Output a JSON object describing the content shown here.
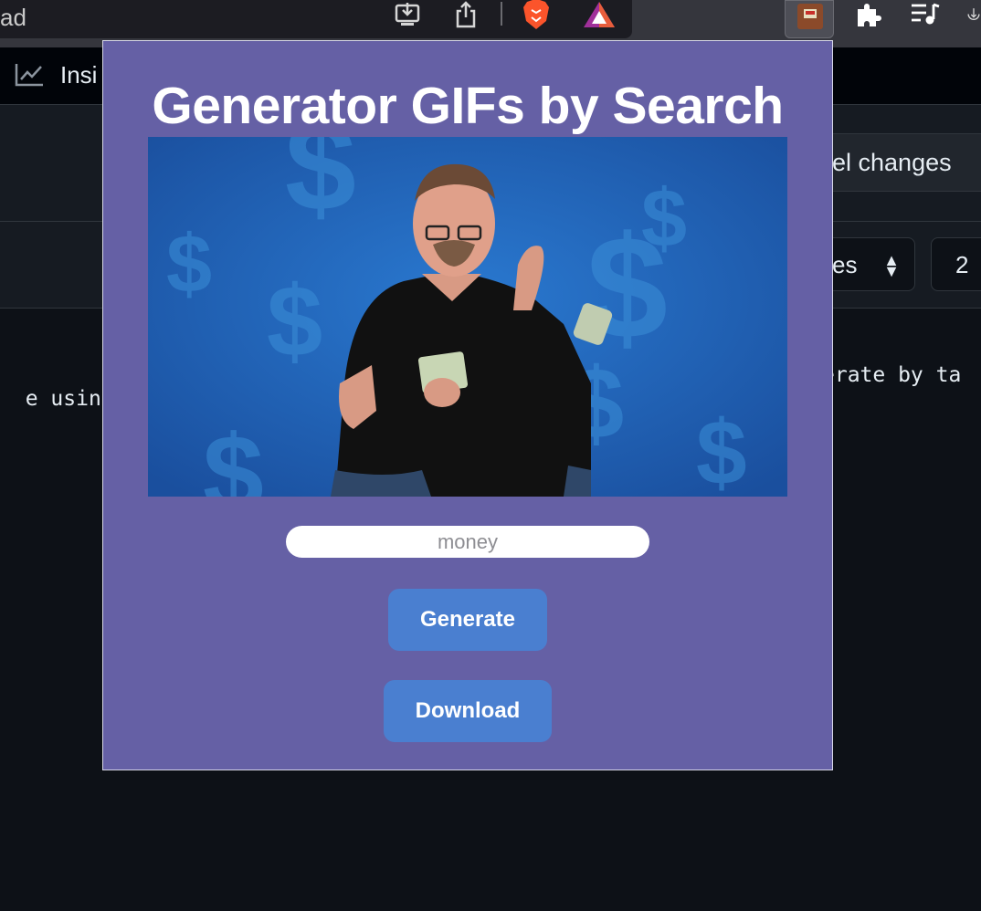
{
  "browser": {
    "url_fragment": "ad",
    "icons": [
      "install-app-icon",
      "share-icon",
      "brave-shields-icon",
      "brave-rewards-icon",
      "gif-extension-icon",
      "extensions-puzzle-icon",
      "playlist-icon",
      "download-icon"
    ]
  },
  "background_page": {
    "nav_insights_label": "Insi",
    "cancel_button_label": "el changes",
    "select_label": "es",
    "indent_value": "2",
    "code_left": "e using F",
    "code_right": "erate by ta"
  },
  "popup": {
    "title": "Generator GIFs by Search",
    "search": {
      "value": "",
      "placeholder": "money"
    },
    "generate_label": "Generate",
    "download_label": "Download",
    "colors": {
      "background": "#6560a5",
      "button": "#4a7fd0"
    }
  }
}
